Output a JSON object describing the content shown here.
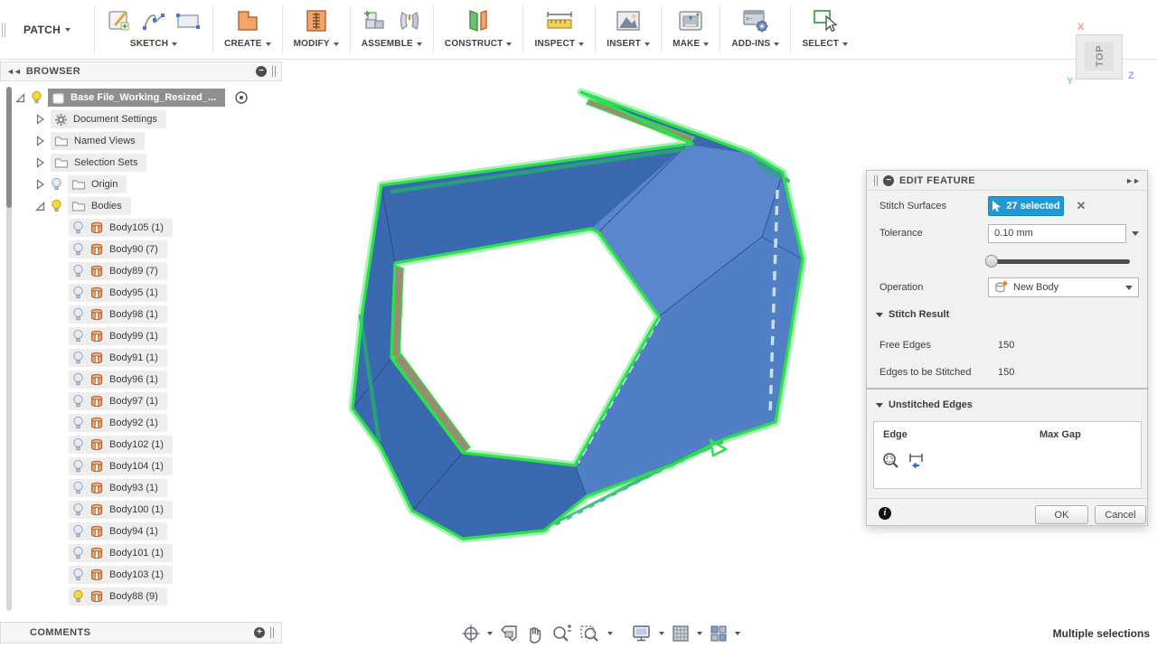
{
  "toolbar": {
    "workspace": "PATCH",
    "groups": [
      "SKETCH",
      "CREATE",
      "MODIFY",
      "ASSEMBLE",
      "CONSTRUCT",
      "INSPECT",
      "INSERT",
      "MAKE",
      "ADD-INS",
      "SELECT"
    ]
  },
  "viewcube": {
    "face": "TOP",
    "axis_x": "X",
    "axis_y": "Y",
    "axis_z": "Z"
  },
  "browser": {
    "title": "BROWSER",
    "root_label": "Base File_Working_Resized_...",
    "items": [
      {
        "label": "Document Settings",
        "icon": "gear-icon"
      },
      {
        "label": "Named Views",
        "icon": "folder-icon"
      },
      {
        "label": "Selection Sets",
        "icon": "folder-icon"
      },
      {
        "label": "Origin",
        "icon": "folder-icon",
        "bulb": "off"
      },
      {
        "label": "Bodies",
        "icon": "folder-icon",
        "bulb": "on"
      }
    ],
    "bodies": [
      {
        "label": "Body105 (1)",
        "visible": false
      },
      {
        "label": "Body90 (7)",
        "visible": false
      },
      {
        "label": "Body89 (7)",
        "visible": false
      },
      {
        "label": "Body95 (1)",
        "visible": false
      },
      {
        "label": "Body98 (1)",
        "visible": false
      },
      {
        "label": "Body99 (1)",
        "visible": false
      },
      {
        "label": "Body91 (1)",
        "visible": false
      },
      {
        "label": "Body96 (1)",
        "visible": false
      },
      {
        "label": "Body97 (1)",
        "visible": false
      },
      {
        "label": "Body92 (1)",
        "visible": false
      },
      {
        "label": "Body102 (1)",
        "visible": false
      },
      {
        "label": "Body104 (1)",
        "visible": false
      },
      {
        "label": "Body93 (1)",
        "visible": false
      },
      {
        "label": "Body100 (1)",
        "visible": false
      },
      {
        "label": "Body94 (1)",
        "visible": false
      },
      {
        "label": "Body101 (1)",
        "visible": false
      },
      {
        "label": "Body103 (1)",
        "visible": false
      },
      {
        "label": "Body88 (9)",
        "visible": true
      }
    ]
  },
  "dialog": {
    "title": "EDIT FEATURE",
    "stitch_surfaces_label": "Stitch Surfaces",
    "selection_button": "27 selected",
    "tolerance_label": "Tolerance",
    "tolerance_value": "0.10 mm",
    "operation_label": "Operation",
    "operation_value": "New Body",
    "stitch_result_section": "Stitch Result",
    "free_edges_label": "Free Edges",
    "free_edges_value": "150",
    "edges_to_stitch_label": "Edges to be Stitched",
    "edges_to_stitch_value": "150",
    "unstitched_section": "Unstitched Edges",
    "table": {
      "col_edge": "Edge",
      "col_max_gap": "Max Gap"
    },
    "ok": "OK",
    "cancel": "Cancel"
  },
  "comments": {
    "title": "COMMENTS"
  },
  "statusbar": {
    "selection_status": "Multiple selections"
  },
  "nav_toolbar_icons": [
    "orbit-icon",
    "look-at-icon",
    "pan-icon",
    "zoom-icon",
    "window-zoom-icon",
    "display-settings-icon",
    "grid-settings-icon",
    "viewports-icon"
  ],
  "colors": {
    "accent_blue": "#1f9ad6",
    "selection_green": "#2ae14b",
    "body_orange": "#f0a263",
    "face_blue": "#4371b5"
  }
}
